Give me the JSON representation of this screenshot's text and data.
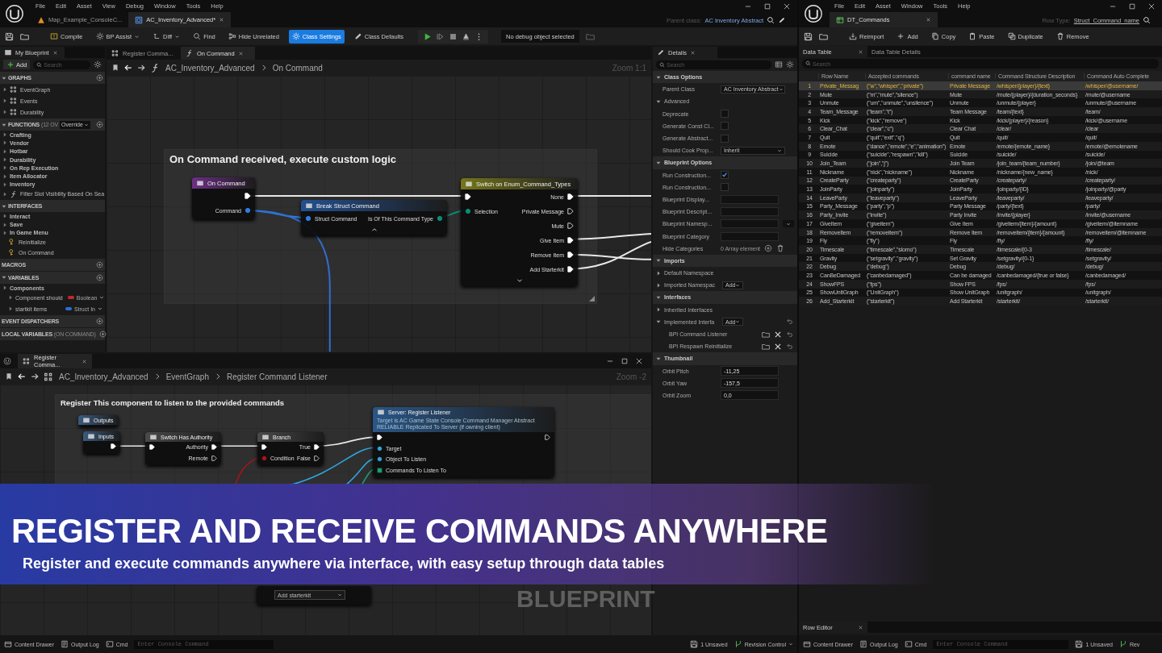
{
  "editor": {
    "menu": [
      "File",
      "Edit",
      "Asset",
      "View",
      "Debug",
      "Window",
      "Tools",
      "Help"
    ],
    "tabs": [
      {
        "label": "Map_Example_ConsoleC...",
        "kind": "map",
        "selected": false
      },
      {
        "label": "AC_Inventory_Advanced*",
        "kind": "blueprint",
        "selected": true
      }
    ],
    "parent_class_label": "Parent class:",
    "parent_class": "AC Inventory Abstract",
    "toolbar": [
      {
        "label": "Compile",
        "kind": "compile",
        "has_menu": false,
        "selected": false
      },
      {
        "label": "BP Assist",
        "kind": "assist",
        "has_menu": true,
        "selected": false
      },
      {
        "label": "Diff",
        "kind": "diff",
        "has_menu": true,
        "selected": false
      },
      {
        "label": "Find",
        "kind": "find",
        "has_menu": false,
        "selected": false
      },
      {
        "label": "Hide Unrelated",
        "kind": "hide",
        "has_menu": false,
        "selected": false
      },
      {
        "label": "Class Settings",
        "kind": "settings",
        "has_menu": false,
        "selected": true
      },
      {
        "label": "Class Defaults",
        "kind": "defaults",
        "has_menu": false,
        "selected": false
      }
    ],
    "debug_filter": "No debug object selected",
    "my_blueprint": {
      "title": "My Blueprint",
      "add": "Add",
      "search_placeholder": "Search",
      "sections": [
        {
          "title": "GRAPHS",
          "addable": true,
          "items": [
            {
              "label": "EventGraph",
              "kind": "graph"
            },
            {
              "label": "Events",
              "kind": "graph"
            },
            {
              "label": "Durability",
              "kind": "graph"
            }
          ]
        },
        {
          "title": "FUNCTIONS",
          "note": "(12 OV",
          "dropdown": "Override",
          "addable": true,
          "items": [
            {
              "label": "Crafting",
              "kind": "category"
            },
            {
              "label": "Vendor",
              "kind": "category"
            },
            {
              "label": "Hotbar",
              "kind": "category"
            },
            {
              "label": "Durability",
              "kind": "category"
            },
            {
              "label": "On Rep Execution",
              "kind": "category"
            },
            {
              "label": "Item Allocator",
              "kind": "category"
            },
            {
              "label": "Inventory",
              "kind": "category"
            },
            {
              "label": "Filter Slot Visibility Based On Sea",
              "kind": "function"
            }
          ]
        },
        {
          "title": "INTERFACES",
          "addable": false,
          "items": [
            {
              "label": "Interact",
              "kind": "category"
            },
            {
              "label": "Save",
              "kind": "category"
            },
            {
              "label": "In Game Menu",
              "kind": "category"
            },
            {
              "label": "Reinitialize",
              "kind": "interface"
            },
            {
              "label": "On Command",
              "kind": "interface"
            }
          ]
        },
        {
          "title": "MACROS",
          "addable": true
        },
        {
          "title": "VARIABLES",
          "addable": true,
          "items": [
            {
              "label": "Components",
              "kind": "category"
            },
            {
              "label": "Component should",
              "kind": "variable",
              "type": "Boolean",
              "color": "#c8262c"
            },
            {
              "label": "startkit items",
              "kind": "variable",
              "type": "Struct In",
              "color": "#2a6fd6"
            }
          ]
        },
        {
          "title": "EVENT DISPATCHERS",
          "addable": true
        },
        {
          "title": "LOCAL VARIABLES",
          "note": "(ON COMMAND)",
          "addable": true
        }
      ]
    },
    "graph": {
      "tabs": [
        {
          "label": "Register Comma...",
          "kind": "graph",
          "selected": false
        },
        {
          "label": "On Command",
          "kind": "function",
          "selected": true
        }
      ],
      "breadcrumb": [
        "AC_Inventory_Advanced",
        "On Command"
      ],
      "zoom": "Zoom 1:1",
      "comment": "On Command received, execute custom logic",
      "nodes": [
        {
          "title": "On Command",
          "kind": "event",
          "outputs": [
            {
              "kind": "exec",
              "connected": true
            },
            {
              "label": "Command",
              "kind": "struct",
              "connected": true
            }
          ]
        },
        {
          "title": "Break Struct Command",
          "kind": "struct",
          "advanced_expanded": true,
          "inputs": [
            {
              "label": "Struct Command",
              "kind": "struct",
              "connected": true
            }
          ],
          "outputs": [
            {
              "label": "Is Of This Command Type",
              "kind": "enum",
              "connected": true
            }
          ]
        },
        {
          "title": "Switch on Enum_Command_Types",
          "kind": "switch",
          "advanced_expanded": false,
          "inputs": [
            {
              "kind": "exec",
              "connected": true
            },
            {
              "label": "Selection",
              "kind": "enum",
              "connected": true
            }
          ],
          "outputs": [
            {
              "label": "None",
              "kind": "exec",
              "connected": true
            },
            {
              "label": "Private Message",
              "kind": "exec",
              "connected": false
            },
            {
              "label": "Mute",
              "kind": "exec",
              "connected": false
            },
            {
              "label": "Give Item",
              "kind": "exec",
              "connected": true
            },
            {
              "label": "Remove Item",
              "kind": "exec",
              "connected": true
            },
            {
              "label": "Add Starterkit",
              "kind": "exec",
              "connected": true
            }
          ]
        }
      ]
    },
    "sub_window": {
      "tab": "Register Comma...",
      "breadcrumb": [
        "AC_Inventory_Advanced",
        "EventGraph",
        "Register Command Listener"
      ],
      "zoom": "Zoom -2",
      "comment": "Register This component to listen to the provided commands",
      "nodes": [
        {
          "title": "Outputs",
          "kind": "tunnel"
        },
        {
          "title": "Inputs",
          "kind": "tunnel",
          "outputs": [
            {
              "kind": "exec",
              "connected": true
            }
          ]
        },
        {
          "title": "Switch Has Authority",
          "kind": "macro",
          "inputs": [
            {
              "kind": "exec",
              "connected": true
            }
          ],
          "outputs": [
            {
              "label": "Authority",
              "kind": "exec",
              "connected": true
            },
            {
              "label": "Remote",
              "kind": "exec",
              "connected": false
            }
          ]
        },
        {
          "title": "Branch",
          "kind": "macro",
          "inputs": [
            {
              "kind": "exec",
              "connected": true
            },
            {
              "label": "Condition",
              "kind": "bool",
              "connected": true
            }
          ],
          "outputs": [
            {
              "label": "True",
              "kind": "exec",
              "connected": true
            },
            {
              "label": "False",
              "kind": "exec",
              "connected": false
            }
          ]
        },
        {
          "title": "Server: Register Listener",
          "kind": "function",
          "subtitle": [
            "Target is AC Game State Console Command Manager Abstract",
            "RELIABLE Replicated To Server (if owning client)"
          ],
          "inputs": [
            {
              "kind": "exec",
              "connected": true
            },
            {
              "label": "Target",
              "kind": "object",
              "connected": true
            },
            {
              "label": "Object To Listen",
              "kind": "object",
              "connected": true
            },
            {
              "label": "Commands To Listen To",
              "kind": "array",
              "connected": true
            }
          ],
          "outputs": [
            {
              "kind": "exec",
              "connected": false
            }
          ]
        },
        {
          "kind": "selector",
          "value": "Add starterkit"
        }
      ]
    },
    "details": {
      "title": "Details",
      "search_placeholder": "Search",
      "rows": [
        {
          "kind": "header",
          "label": "Class Options"
        },
        {
          "kind": "dropdown",
          "label": "Parent Class",
          "value": "AC Inventory Abstract"
        },
        {
          "kind": "group",
          "label": "Advanced",
          "expanded": true
        },
        {
          "kind": "checkbox",
          "label": "Deprecate",
          "checked": false
        },
        {
          "kind": "checkbox",
          "label": "Generate Const Cl...",
          "checked": false
        },
        {
          "kind": "checkbox",
          "label": "Generate Abstract...",
          "checked": false
        },
        {
          "kind": "dropdown",
          "label": "Should Cook Prop...",
          "value": "Inherit"
        },
        {
          "kind": "header",
          "label": "Blueprint Options"
        },
        {
          "kind": "checkbox",
          "label": "Run Construction...",
          "checked": true
        },
        {
          "kind": "checkbox",
          "label": "Run Construction...",
          "checked": false
        },
        {
          "kind": "text",
          "label": "Blueprint Display..."
        },
        {
          "kind": "text",
          "label": "Blueprint Descript..."
        },
        {
          "kind": "combo",
          "label": "Blueprint Namesp..."
        },
        {
          "kind": "text",
          "label": "Blueprint Category"
        },
        {
          "kind": "array",
          "label": "Hide Categories",
          "value": "0 Array element"
        },
        {
          "kind": "header",
          "label": "Imports"
        },
        {
          "kind": "group",
          "label": "Default Namespace",
          "expanded": false
        },
        {
          "kind": "add",
          "label": "Imported Namespac",
          "value": "Add",
          "expanded": false
        },
        {
          "kind": "header",
          "label": "Interfaces"
        },
        {
          "kind": "group",
          "label": "Inherited Interfaces",
          "expanded": false
        },
        {
          "kind": "add",
          "label": "Implemented Interfa",
          "value": "Add",
          "expanded": true
        },
        {
          "kind": "interface",
          "label": "BPI Command Listener"
        },
        {
          "kind": "interface",
          "label": "BPI Respawn Reinitialize"
        },
        {
          "kind": "header",
          "label": "Thumbnail"
        },
        {
          "kind": "number",
          "label": "Orbit Pitch",
          "value": "-11,25"
        },
        {
          "kind": "number",
          "label": "Orbit Yaw",
          "value": "-157,5"
        },
        {
          "kind": "number",
          "label": "Orbit Zoom",
          "value": "0,0"
        }
      ]
    },
    "status_bar": {
      "items": [
        {
          "label": "Content Drawer",
          "kind": "drawer"
        },
        {
          "label": "Output Log",
          "kind": "log"
        },
        {
          "label": "Cmd",
          "kind": "cmd"
        }
      ],
      "console_placeholder": "Enter Console Command",
      "unsaved": "1 Unsaved",
      "revision": "Revision Control"
    }
  },
  "data_table_window": {
    "menu": [
      "File",
      "Edit",
      "Asset",
      "Window",
      "Tools",
      "Help"
    ],
    "tab": "DT_Commands",
    "row_type_label": "Row Type:",
    "row_type": "Struct_Command_name",
    "toolbar": [
      {
        "label": "Reimport",
        "kind": "reimport"
      },
      {
        "label": "Add",
        "kind": "add"
      },
      {
        "label": "Copy",
        "kind": "copy"
      },
      {
        "label": "Paste",
        "kind": "paste"
      },
      {
        "label": "Duplicate",
        "kind": "duplicate"
      },
      {
        "label": "Remove",
        "kind": "remove"
      }
    ],
    "panel_tabs": [
      {
        "label": "Data Table",
        "selected": true
      },
      {
        "label": "Data Table Details",
        "selected": false
      }
    ],
    "search_placeholder": "Search",
    "columns": [
      "Row Name",
      "Accepted commands",
      "command name",
      "Command Structure Description",
      "Command Auto Complete"
    ],
    "rows": [
      {
        "index": "1",
        "cells": [
          "Private_Messag",
          "(\"w\",\"whisper\",\"private\")",
          "Private Message",
          "/whisper/{player}/{text}",
          "/whisper/@username/"
        ],
        "selected": true
      },
      {
        "index": "2",
        "cells": [
          "Mute",
          "(\"m\",\"mute\",\"silence\")",
          "Mute",
          "/mute/{player}/{duration_seconds}",
          "/mute/@username"
        ],
        "selected": false
      },
      {
        "index": "3",
        "cells": [
          "Unmute",
          "(\"um\",\"unmute\",\"unsilence\")",
          "Unmute",
          "/unmute/{player}",
          "/unmute/@username"
        ],
        "selected": false
      },
      {
        "index": "4",
        "cells": [
          "Team_Message",
          "(\"team\",\"t\")",
          "Team Message",
          "/team/{text}",
          "/team/"
        ],
        "selected": false
      },
      {
        "index": "5",
        "cells": [
          "Kick",
          "(\"kick\",\"remove\")",
          "Kick",
          "/kick/{player}/{reason}",
          "/kick/@username"
        ],
        "selected": false
      },
      {
        "index": "6",
        "cells": [
          "Clear_Chat",
          "(\"clear\",\"c\")",
          "Clear Chat",
          "/clear/",
          "/clear"
        ],
        "selected": false
      },
      {
        "index": "7",
        "cells": [
          "Quit",
          "(\"quit\",\"exit\",\"q\")",
          "Quit",
          "/quit/",
          "/quit/"
        ],
        "selected": false
      },
      {
        "index": "8",
        "cells": [
          "Emote",
          "(\"dance\",\"emote\",\"e\",\"animation\")",
          "Emote",
          "/emote/{emote_name}",
          "/emote/@emotename"
        ],
        "selected": false
      },
      {
        "index": "9",
        "cells": [
          "Suicide",
          "(\"suicide\",\"respawn\",\"kill\")",
          "Suicide",
          "/suicide/",
          "/suicide/"
        ],
        "selected": false
      },
      {
        "index": "10",
        "cells": [
          "Join_Team",
          "(\"join\",\"j\")",
          "Join Team",
          "/join_team/{team_number}",
          "/join/@team"
        ],
        "selected": false
      },
      {
        "index": "11",
        "cells": [
          "Nickname",
          "(\"nick\",\"nickname\")",
          "Nickname",
          "/nickname/{new_name}",
          "/nick/"
        ],
        "selected": false
      },
      {
        "index": "12",
        "cells": [
          "CreateParty",
          "(\"createparty\")",
          "CreateParty",
          "/createparty/",
          "/createparty/"
        ],
        "selected": false
      },
      {
        "index": "13",
        "cells": [
          "JoinParty",
          "(\"joinparty\")",
          "JoinParty",
          "/joinparty/{ID}",
          "/joinparty/@party"
        ],
        "selected": false
      },
      {
        "index": "14",
        "cells": [
          "LeaveParty",
          "(\"leaveparty\")",
          "LeaveParty",
          "/leaveparty/",
          "/leaveparty/"
        ],
        "selected": false
      },
      {
        "index": "15",
        "cells": [
          "Party_Message",
          "(\"party\",\"p\")",
          "Party Message",
          "/party/{text}",
          "/party/"
        ],
        "selected": false
      },
      {
        "index": "16",
        "cells": [
          "Party_Invite",
          "(\"invite\")",
          "Party Invite",
          "/invite/{player}",
          "/invite/@username"
        ],
        "selected": false
      },
      {
        "index": "17",
        "cells": [
          "GiveItem",
          "(\"giveitem\")",
          "Give Item",
          "/giveitem/{item}/{amount}",
          "/giveitem/@itemname"
        ],
        "selected": false
      },
      {
        "index": "18",
        "cells": [
          "RemoveItem",
          "(\"removeitem\")",
          "Remove Item",
          "/removeitem/{item}/{amount}",
          "/removeitem/@itemname"
        ],
        "selected": false
      },
      {
        "index": "19",
        "cells": [
          "Fly",
          "(\"fly\")",
          "Fly",
          "/fly/",
          "/fly/"
        ],
        "selected": false
      },
      {
        "index": "20",
        "cells": [
          "Timescale",
          "(\"timescale\",\"slomo\")",
          "Timescale",
          "/timescale/{0-3",
          "/timescale/"
        ],
        "selected": false
      },
      {
        "index": "21",
        "cells": [
          "Gravity",
          "(\"setgravity\",\"gravity\")",
          "Set Gravity",
          "/setgravity/{0-1}",
          "/setgravity/"
        ],
        "selected": false
      },
      {
        "index": "22",
        "cells": [
          "Debug",
          "(\"debug\")",
          "Debug",
          "/debug/",
          "/debug/"
        ],
        "selected": false
      },
      {
        "index": "23",
        "cells": [
          "CanBeDamaged",
          "(\"canbedamaged\")",
          "Can be damaged",
          "/canbedamaged/{true or false}",
          "/canbedamaged/"
        ],
        "selected": false
      },
      {
        "index": "24",
        "cells": [
          "ShowFPS",
          "(\"fps\")",
          "Show FPS",
          "/fps/",
          "/fps/"
        ],
        "selected": false
      },
      {
        "index": "25",
        "cells": [
          "ShowUnitGraph",
          "(\"UnitGraph\")",
          "Show UnitGraph",
          "/unitgraph/",
          "/unitgraph/"
        ],
        "selected": false
      },
      {
        "index": "26",
        "cells": [
          "Add_Starterkit",
          "(\"starterkit\")",
          "Add Starterkit",
          "/starterkit/",
          "/starterkit/"
        ],
        "selected": false
      }
    ],
    "row_editor_tab": "Row Editor",
    "status_bar": {
      "items": [
        {
          "label": "Content Drawer",
          "kind": "drawer"
        },
        {
          "label": "Output Log",
          "kind": "log"
        },
        {
          "label": "Cmd",
          "kind": "cmd"
        }
      ],
      "console_placeholder": "Enter Console Command",
      "unsaved": "1 Unsaved",
      "revision": "Rev"
    }
  },
  "banner": {
    "headline": "REGISTER AND RECEIVE COMMANDS ANYWHERE",
    "subtitle": "Register and execute commands anywhere via interface, with easy setup through data tables",
    "badge": "BLUEPRINT"
  }
}
